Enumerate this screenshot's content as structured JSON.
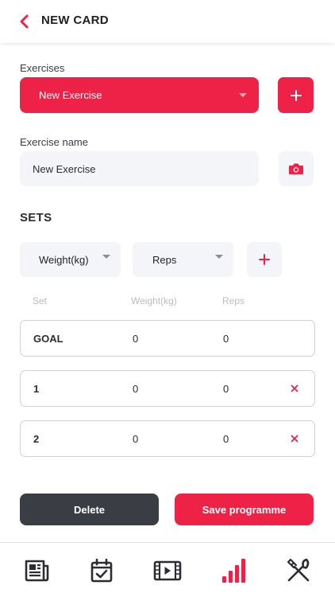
{
  "header": {
    "title": "NEW CARD",
    "back_icon": "chevron-left-icon"
  },
  "exercises": {
    "label": "Exercises",
    "selected": "New Exercise",
    "add_icon": "plus-icon"
  },
  "exercise_name": {
    "label": "Exercise name",
    "value": "New Exercise",
    "camera_icon": "camera-icon"
  },
  "sets": {
    "title": "SETS",
    "filter_1": "Weight(kg)",
    "filter_2": "Reps",
    "add_icon": "plus-icon",
    "columns": {
      "set": "Set",
      "weight": "Weight(kg)",
      "reps": "Reps"
    },
    "rows": [
      {
        "set": "GOAL",
        "weight": "0",
        "reps": "0"
      },
      {
        "set": "1",
        "weight": "0",
        "reps": "0"
      },
      {
        "set": "2",
        "weight": "0",
        "reps": "0"
      }
    ]
  },
  "actions": {
    "delete": "Delete",
    "save": "Save programme"
  },
  "colors": {
    "accent": "#ee2247",
    "dark": "#3a3d44",
    "field": "#f4f5f8"
  },
  "bottom_nav": [
    {
      "icon": "newspaper-icon",
      "active": false
    },
    {
      "icon": "calendar-check-icon",
      "active": false
    },
    {
      "icon": "video-icon",
      "active": false
    },
    {
      "icon": "bar-chart-icon",
      "active": true
    },
    {
      "icon": "fork-knife-icon",
      "active": false
    }
  ]
}
